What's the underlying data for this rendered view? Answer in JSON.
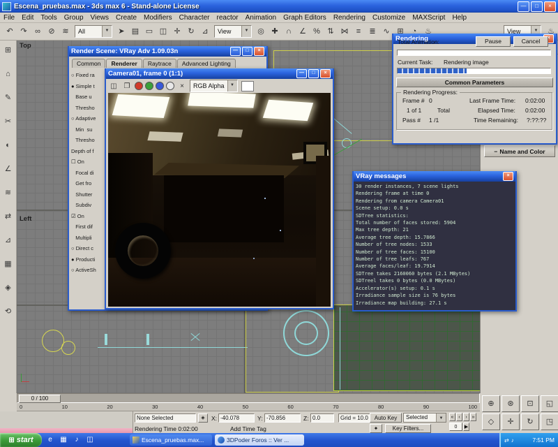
{
  "window": {
    "title": "Escena_pruebas.max - 3ds max 6 - Stand-alone License"
  },
  "window_chrome": {
    "minimize": "—",
    "maximize": "□",
    "close": "×"
  },
  "glyphs": {
    "down": "▼",
    "play": "▶",
    "lock": "◈",
    "key": "✦",
    "flag": "⊞",
    "minus": "−"
  },
  "menu": {
    "items": [
      "File",
      "Edit",
      "Tools",
      "Group",
      "Views",
      "Create",
      "Modifiers",
      "Character",
      "reactor",
      "Animation",
      "Graph Editors",
      "Rendering",
      "Customize",
      "MAXScript",
      "Help"
    ]
  },
  "main_toolbar": {
    "filter_value": "All",
    "ref_coord_value": "View",
    "render_type_value": "View",
    "icons_a": [
      {
        "name": "undo-icon",
        "text": "↶"
      },
      {
        "name": "redo-icon",
        "text": "↷"
      },
      {
        "name": "select-and-link-icon",
        "text": "∞"
      },
      {
        "name": "unlink-selection-icon",
        "text": "⊘"
      },
      {
        "name": "bind-to-spacewarp-icon",
        "text": "≋"
      }
    ],
    "icons_b": [
      {
        "name": "select-object-icon",
        "text": "➤"
      },
      {
        "name": "select-by-name-icon",
        "text": "▤"
      },
      {
        "name": "rectangular-selection-region-icon",
        "text": "▭"
      },
      {
        "name": "window-crossing-icon",
        "text": "◫"
      },
      {
        "name": "select-and-move-icon",
        "text": "✛"
      },
      {
        "name": "select-and-rotate-icon",
        "text": "↻"
      },
      {
        "name": "select-and-scale-icon",
        "text": "⊿"
      }
    ],
    "icons_c": [
      {
        "name": "use-pivot-center-icon",
        "text": "◎"
      },
      {
        "name": "select-and-manipulate-icon",
        "text": "✚"
      },
      {
        "name": "snap-toggle-icon",
        "text": "∩"
      },
      {
        "name": "angle-snap-icon",
        "text": "∠"
      },
      {
        "name": "percent-snap-icon",
        "text": "%"
      },
      {
        "name": "spinner-snap-icon",
        "text": "⇅"
      },
      {
        "name": "mirror-icon",
        "text": "⋈"
      },
      {
        "name": "align-icon",
        "text": "≡"
      },
      {
        "name": "layer-manager-icon",
        "text": "≣"
      },
      {
        "name": "curve-editor-icon",
        "text": "∿"
      },
      {
        "name": "schematic-view-icon",
        "text": "⊞"
      },
      {
        "name": "material-editor-icon",
        "text": "◔"
      },
      {
        "name": "render-scene-icon",
        "text": "♨"
      }
    ],
    "icons_d": [
      {
        "name": "quick-render-icon",
        "text": "♨"
      }
    ]
  },
  "left_toolbar": {
    "icons": [
      {
        "name": "left-tool-icon-1",
        "text": "⊞"
      },
      {
        "name": "left-tool-icon-2",
        "text": "⌂"
      },
      {
        "name": "left-tool-icon-3",
        "text": "✎"
      },
      {
        "name": "left-tool-icon-4",
        "text": "✂"
      },
      {
        "name": "left-tool-icon-5",
        "text": "◐"
      },
      {
        "name": "left-tool-icon-6",
        "text": "∠"
      },
      {
        "name": "left-tool-icon-7",
        "text": "≋"
      },
      {
        "name": "left-tool-icon-8",
        "text": "⇄"
      },
      {
        "name": "left-tool-icon-9",
        "text": "⊿"
      },
      {
        "name": "left-tool-icon-10",
        "text": "▦"
      },
      {
        "name": "left-tool-icon-11",
        "text": "◈"
      },
      {
        "name": "left-tool-icon-12",
        "text": "⟲"
      }
    ]
  },
  "viewports": {
    "top_label": "Top",
    "left_label": "Left"
  },
  "render_scene": {
    "title": "Render Scene: VRay Adv 1.09.03n",
    "tabs": [
      "Common",
      "Renderer",
      "Raytrace",
      "Advanced Lighting"
    ],
    "left_items": [
      "○ Fixed ra",
      "● Simple t",
      "   Base u",
      "   Thresho",
      "○ Adaptive",
      "   Min  su",
      "   Thresho",
      "Depth of f",
      "☐ On",
      "   Focal di",
      "   Get fro",
      "   Shutter",
      "   Subdiv",
      "",
      "☑ On",
      "   First dif",
      "   Multipli",
      "○ Direct c",
      "",
      "● Producti",
      "○ ActiveSh"
    ]
  },
  "camera_window": {
    "title": "Camera01, frame 0 (1:1)",
    "save_icon": "◫",
    "clone_icon": "❐",
    "clear_icon": "×",
    "channel_value": "RGB Alpha"
  },
  "rendering_dialog": {
    "title": "Rendering",
    "total_animation_label": "Total Animation:",
    "pause_label": "Pause",
    "cancel_label": "Cancel",
    "current_task_label": "Current Task:",
    "current_task_value": "Rendering image",
    "progress_percent": 45,
    "common_parameters_label": "Common Parameters",
    "rendering_progress_label": "Rendering Progress:",
    "frame_label": "Frame #",
    "frame_value": "0",
    "of_label": "1 of 1",
    "total_label": "Total",
    "last_frame_time_label": "Last Frame Time:",
    "last_frame_time_value": "0:02:00",
    "elapsed_time_label": "Elapsed Time:",
    "elapsed_time_value": "0:02:00",
    "pass_label": "Pass #",
    "pass_value": "1 /1",
    "time_remaining_label": "Time Remaining:",
    "time_remaining_value": "?:??:??"
  },
  "vray_messages": {
    "title": "VRay messages",
    "lines": [
      "30 render instances, 7 scene lights",
      "Rendering frame at time 0",
      "Rendering from camera Camera01",
      "Scene setup: 0.0 s",
      "SDTree statistics:",
      "Total number of faces stored: 5904",
      "Max tree depth: 21",
      "Average tree depth: 15.7866",
      "Number of tree nodes: 1533",
      "Number of tree faces: 15100",
      "Number of tree leafs: 767",
      "Average faces/leaf: 19.7914",
      "SDTree takes 2160060 bytes (2.1 MBytes)",
      "SDTreel takes 0 bytes (0.0 MBytes)",
      "Accelerator(s) setup: 0.1 s",
      "Irradiance sample size is 76 bytes",
      "Irradiance map building: 27.1 s"
    ]
  },
  "command_panel": {
    "tabs": [
      {
        "name": "tab-create-icon",
        "text": "✦"
      },
      {
        "name": "tab-modify-icon",
        "text": "◧"
      },
      {
        "name": "tab-hierarchy-icon",
        "text": "⊟"
      },
      {
        "name": "tab-motion-icon",
        "text": "◉"
      },
      {
        "name": "tab-display-icon",
        "text": "▢"
      },
      {
        "name": "tab-utilities-icon",
        "text": "✶"
      }
    ],
    "name_color_label": "Name and Color"
  },
  "timeline": {
    "slider_value": "0 / 100",
    "ticks": [
      "0",
      "10",
      "20",
      "30",
      "40",
      "50",
      "60",
      "70",
      "80",
      "90",
      "100"
    ]
  },
  "status_bar": {
    "selection": "None Selected",
    "x_label": "X:",
    "x_value": "-40.078",
    "y_label": "Y:",
    "y_value": "-70.856",
    "z_label": "Z:",
    "z_value": "0.0",
    "grid": "Grid = 10.0",
    "rendering_time": "Rendering Time 0:02:00",
    "add_time_tag": "Add Time Tag",
    "auto_key": "Auto Key",
    "selected_dropdown": "Selected",
    "key_filters": "Key Filters...",
    "frame_field": "0",
    "transport": [
      {
        "name": "go-to-start-button",
        "text": "«"
      },
      {
        "name": "previous-frame-button",
        "text": "‹"
      },
      {
        "name": "next-frame-button",
        "text": "›"
      },
      {
        "name": "go-to-end-button",
        "text": "»"
      }
    ]
  },
  "nav_cluster": {
    "icons": [
      {
        "name": "zoom-icon",
        "text": "⊕"
      },
      {
        "name": "zoom-all-icon",
        "text": "⊛"
      },
      {
        "name": "zoom-extents-icon",
        "text": "⊡"
      },
      {
        "name": "zoom-extents-all-icon",
        "text": "◱"
      },
      {
        "name": "field-of-view-icon",
        "text": "◇"
      },
      {
        "name": "pan-icon",
        "text": "✛"
      },
      {
        "name": "arc-rotate-icon",
        "text": "↻"
      },
      {
        "name": "min-max-toggle-icon",
        "text": "◳"
      }
    ]
  },
  "taskbar": {
    "start_label": "start",
    "quick": [
      {
        "name": "quicklaunch-ie-icon",
        "text": "e"
      },
      {
        "name": "quicklaunch-show-desktop-icon",
        "text": "▦"
      },
      {
        "name": "quicklaunch-media-icon",
        "text": "♪"
      },
      {
        "name": "quicklaunch-folder-icon",
        "text": "◫"
      }
    ],
    "tasks": [
      "Escena_pruebas.max...",
      "3DPoder Foros :: Ver ..."
    ],
    "tray_icons": [
      {
        "name": "tray-network-icon",
        "text": "⇄"
      },
      {
        "name": "tray-volume-icon",
        "text": "♪"
      }
    ],
    "time": "7:51 PM"
  }
}
